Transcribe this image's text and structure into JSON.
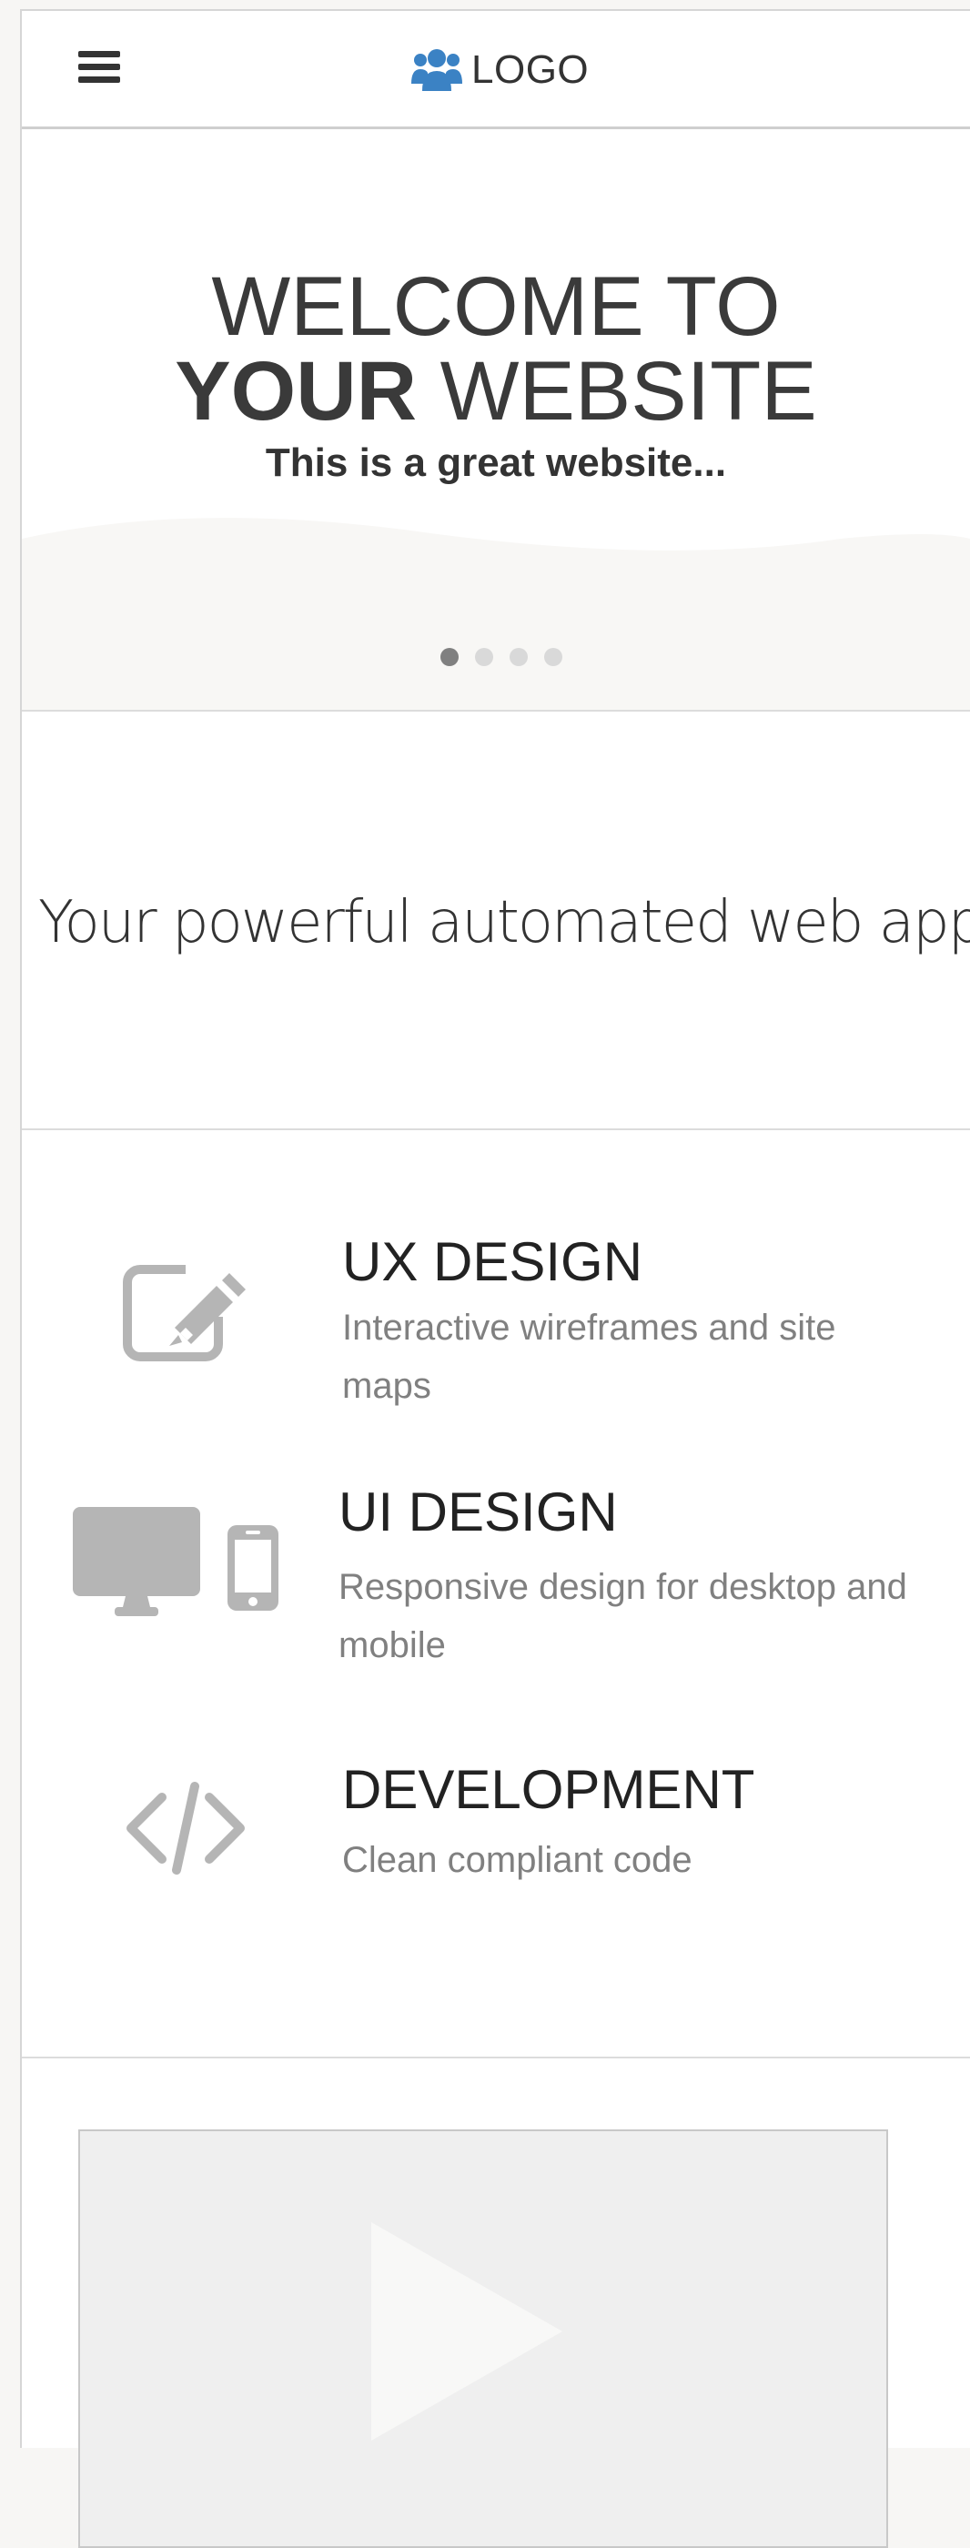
{
  "header": {
    "menu_icon": "hamburger-menu-icon",
    "logo_icon": "users-icon",
    "logo_text": "LOGO",
    "logo_color": "#3b82c4"
  },
  "hero": {
    "title_line1": "WELCOME TO",
    "title_line2_bold": "YOUR",
    "title_line2_rest": " WEBSITE",
    "subtitle": "This is a great website...",
    "slides_total": 4,
    "slides_active": 1
  },
  "tagline": "Your powerful automated web app!",
  "features": [
    {
      "icon": "edit-icon",
      "title": "UX DESIGN",
      "desc": "Interactive wireframes and site maps"
    },
    {
      "icon": "devices-icon",
      "title": "UI DESIGN",
      "desc": "Responsive design for desktop and mobile"
    },
    {
      "icon": "code-icon",
      "title": "DEVELOPMENT",
      "desc": "Clean compliant code"
    }
  ],
  "video": {
    "icon": "play-icon"
  }
}
